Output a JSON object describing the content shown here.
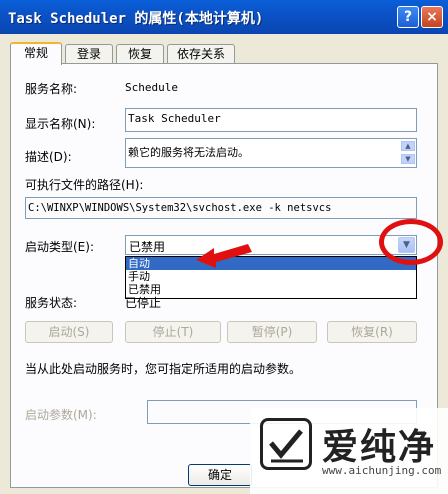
{
  "window": {
    "title": "Task Scheduler 的属性(本地计算机)",
    "help_glyph": "?",
    "close_glyph": "×"
  },
  "tabs": [
    {
      "label": "常规",
      "active": true
    },
    {
      "label": "登录"
    },
    {
      "label": "恢复"
    },
    {
      "label": "依存关系"
    }
  ],
  "general": {
    "service_name_label": "服务名称:",
    "service_name_value": "Schedule",
    "display_name_label": "显示名称(N):",
    "display_name_value": "Task Scheduler",
    "description_label": "描述(D):",
    "description_value": "赖它的服务将无法启动。",
    "exe_path_label": "可执行文件的路径(H):",
    "exe_path_value": "C:\\WINXP\\WINDOWS\\System32\\svchost.exe -k netsvcs",
    "startup_type_label": "启动类型(E):",
    "startup_type_value": "已禁用",
    "startup_options": [
      "自动",
      "手动",
      "已禁用"
    ],
    "startup_selected_index": 0,
    "service_status_label": "服务状态:",
    "service_status_value": "已停止",
    "buttons": {
      "start": "启动(S)",
      "stop": "停止(T)",
      "pause": "暂停(P)",
      "resume": "恢复(R)"
    },
    "hint_text": "当从此处启动服务时，您可指定所适用的启动参数。",
    "start_params_label": "启动参数(M):",
    "start_params_value": ""
  },
  "footer": {
    "ok_label": "确定"
  },
  "watermark": {
    "brand": "爱纯净",
    "url": "www.aichunjing.com"
  }
}
